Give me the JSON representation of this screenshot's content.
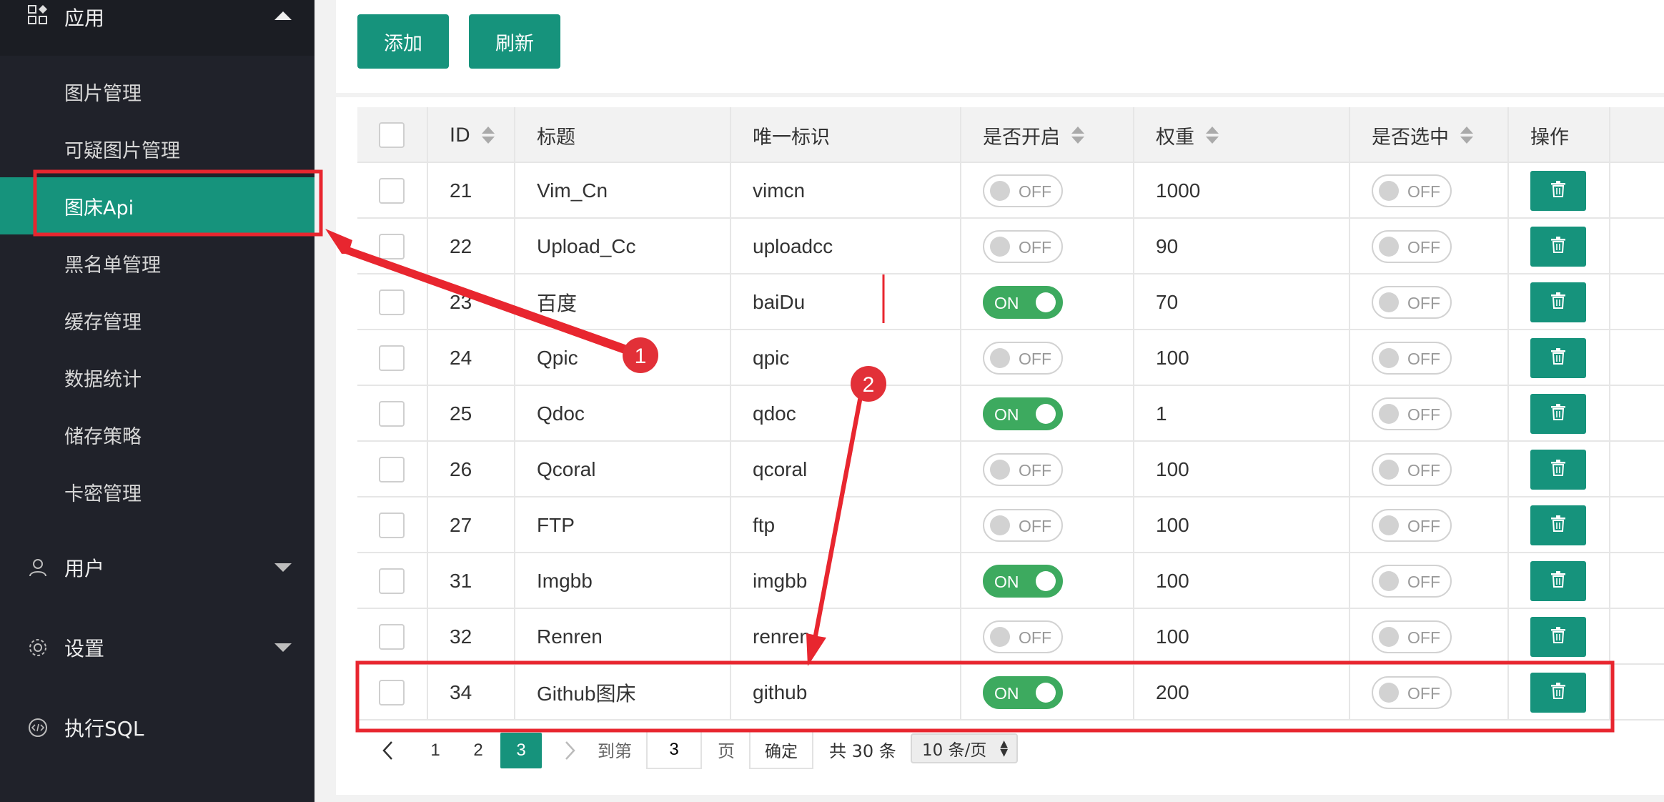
{
  "sidebar": {
    "app_group": {
      "label": "应用"
    },
    "items": [
      {
        "label": "图片管理",
        "active": false
      },
      {
        "label": "可疑图片管理",
        "active": false
      },
      {
        "label": "图床Api",
        "active": true
      },
      {
        "label": "黑名单管理",
        "active": false
      },
      {
        "label": "缓存管理",
        "active": false
      },
      {
        "label": "数据统计",
        "active": false
      },
      {
        "label": "储存策略",
        "active": false
      },
      {
        "label": "卡密管理",
        "active": false
      }
    ],
    "user_group": {
      "label": "用户"
    },
    "settings_group": {
      "label": "设置"
    },
    "sql_group": {
      "label": "执行SQL"
    }
  },
  "toolbar": {
    "add_label": "添加",
    "refresh_label": "刷新"
  },
  "table": {
    "headers": {
      "id": "ID",
      "title": "标题",
      "key": "唯一标识",
      "enabled": "是否开启",
      "weight": "权重",
      "selected": "是否选中",
      "action": "操作"
    },
    "rows": [
      {
        "id": "21",
        "title": "Vim_Cn",
        "key": "vimcn",
        "enabled": "OFF",
        "weight": "1000",
        "selected": "OFF"
      },
      {
        "id": "22",
        "title": "Upload_Cc",
        "key": "uploadcc",
        "enabled": "OFF",
        "weight": "90",
        "selected": "OFF"
      },
      {
        "id": "23",
        "title": "百度",
        "key": "baiDu",
        "enabled": "ON",
        "weight": "70",
        "selected": "OFF"
      },
      {
        "id": "24",
        "title": "Qpic",
        "key": "qpic",
        "enabled": "OFF",
        "weight": "100",
        "selected": "OFF"
      },
      {
        "id": "25",
        "title": "Qdoc",
        "key": "qdoc",
        "enabled": "ON",
        "weight": "1",
        "selected": "OFF"
      },
      {
        "id": "26",
        "title": "Qcoral",
        "key": "qcoral",
        "enabled": "OFF",
        "weight": "100",
        "selected": "OFF"
      },
      {
        "id": "27",
        "title": "FTP",
        "key": "ftp",
        "enabled": "OFF",
        "weight": "100",
        "selected": "OFF"
      },
      {
        "id": "31",
        "title": "Imgbb",
        "key": "imgbb",
        "enabled": "ON",
        "weight": "100",
        "selected": "OFF"
      },
      {
        "id": "32",
        "title": "Renren",
        "key": "renren",
        "enabled": "OFF",
        "weight": "100",
        "selected": "OFF"
      },
      {
        "id": "34",
        "title": "Github图床",
        "key": "github",
        "enabled": "ON",
        "weight": "200",
        "selected": "OFF"
      }
    ]
  },
  "pagination": {
    "pages": [
      "1",
      "2",
      "3"
    ],
    "current": "3",
    "goto_label": "到第",
    "goto_value": "3",
    "page_unit": "页",
    "confirm_label": "确定",
    "total_label": "共 30 条",
    "per_page": "10 条/页"
  },
  "annotations": {
    "marker_1": "1",
    "marker_2": "2"
  },
  "colors": {
    "accent": "#16937c",
    "switch_on": "#3daa5f",
    "annotation": "#e8262f"
  }
}
